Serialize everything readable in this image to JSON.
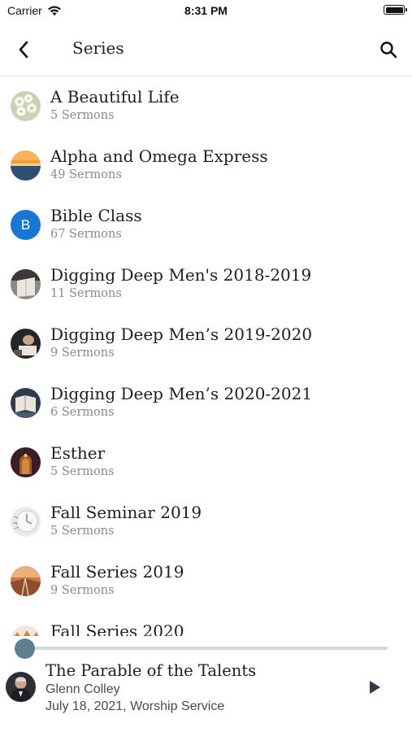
{
  "status_bar": {
    "carrier": "Carrier",
    "time": "8:31 PM",
    "icons": [
      "wifi-icon",
      "battery-icon"
    ]
  },
  "nav": {
    "title": "Series",
    "back_icon": "chevron-left-icon",
    "search_icon": "search-icon"
  },
  "series": [
    {
      "title": "A Beautiful Life",
      "subtitle": "5 Sermons"
    },
    {
      "title": "Alpha and Omega Express",
      "subtitle": "49 Sermons"
    },
    {
      "title": "Bible Class",
      "subtitle": "67 Sermons",
      "avatar_letter": "B",
      "avatar_color": "#1976d2"
    },
    {
      "title": "Digging Deep Men's 2018-2019",
      "subtitle": "11 Sermons"
    },
    {
      "title": "Digging Deep Men’s 2019-2020",
      "subtitle": "9 Sermons"
    },
    {
      "title": "Digging Deep Men’s 2020-2021",
      "subtitle": "6 Sermons"
    },
    {
      "title": "Esther",
      "subtitle": "5 Sermons"
    },
    {
      "title": "Fall Seminar 2019",
      "subtitle": "5 Sermons"
    },
    {
      "title": "Fall Series 2019",
      "subtitle": "9 Sermons"
    },
    {
      "title": "Fall Series 2020",
      "subtitle": ""
    }
  ],
  "player": {
    "title": "The Parable of the Talents",
    "speaker": "Glenn Colley",
    "date_service": "July 18, 2021, Worship Service",
    "progress": 0,
    "play_icon": "play-icon",
    "accent": "#5e7f91"
  }
}
